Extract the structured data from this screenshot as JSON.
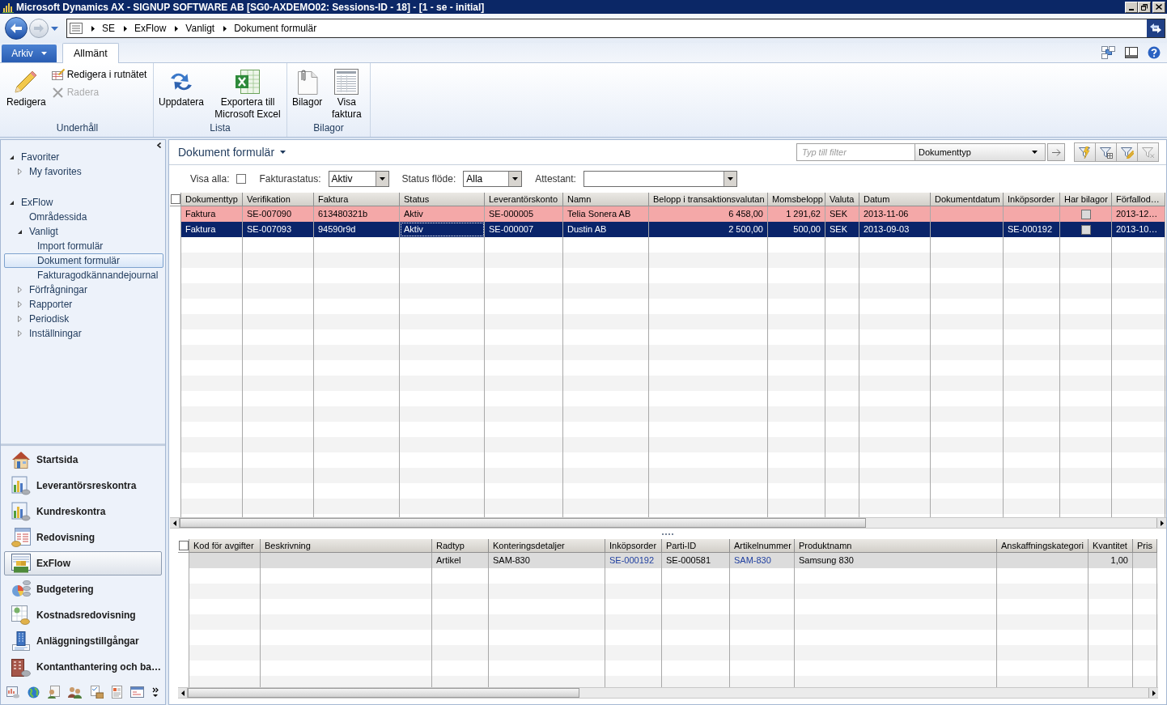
{
  "window": {
    "title": "Microsoft Dynamics AX - SIGNUP SOFTWARE AB [SG0-AXDEMO02: Sessions-ID - 18] - [1 - se - initial]"
  },
  "address_bar": {
    "breadcrumbs": [
      "SE",
      "ExFlow",
      "Vanligt",
      "Dokument formulär"
    ]
  },
  "ribbon": {
    "file_menu": {
      "label": "Arkiv"
    },
    "tabs": [
      {
        "label": "Allmänt",
        "selected": true
      }
    ],
    "groups": [
      {
        "label": "Underhåll",
        "buttons": [
          {
            "label": "Redigera",
            "kind": "large",
            "disabled": false
          },
          {
            "label": "Redigera i rutnätet",
            "kind": "small",
            "disabled": false
          },
          {
            "label": "Radera",
            "kind": "small",
            "disabled": true
          }
        ]
      },
      {
        "label": "Lista",
        "buttons": [
          {
            "label": "Uppdatera",
            "kind": "large",
            "disabled": false
          },
          {
            "label": "Exportera till Microsoft Excel",
            "kind": "large",
            "disabled": false
          }
        ]
      },
      {
        "label": "Bilagor",
        "buttons": [
          {
            "label": "Bilagor",
            "kind": "large",
            "disabled": false
          },
          {
            "label": "Visa faktura",
            "kind": "large",
            "disabled": false
          }
        ]
      }
    ]
  },
  "nav_pane": {
    "tree": [
      {
        "label": "Favoriter",
        "expanded": true,
        "selected": false,
        "children": [
          {
            "label": "My favorites",
            "expanded": false,
            "selected": false
          }
        ]
      },
      {
        "label": "ExFlow",
        "expanded": true,
        "selected": false,
        "children": [
          {
            "label": "Områdessida",
            "selected": false
          },
          {
            "label": "Vanligt",
            "expanded": true,
            "selected": false,
            "children": [
              {
                "label": "Import formulär",
                "selected": false
              },
              {
                "label": "Dokument formulär",
                "selected": true
              },
              {
                "label": "Fakturagodkännandejournal",
                "selected": false
              }
            ]
          },
          {
            "label": "Förfrågningar",
            "expanded": false,
            "selected": false
          },
          {
            "label": "Rapporter",
            "expanded": false,
            "selected": false
          },
          {
            "label": "Periodisk",
            "expanded": false,
            "selected": false
          },
          {
            "label": "Inställningar",
            "expanded": false,
            "selected": false
          }
        ]
      }
    ],
    "modules": [
      {
        "label": "Startsida",
        "selected": false
      },
      {
        "label": "Leverantörsreskontra",
        "selected": false
      },
      {
        "label": "Kundreskontra",
        "selected": false
      },
      {
        "label": "Redovisning",
        "selected": false
      },
      {
        "label": "ExFlow",
        "selected": true
      },
      {
        "label": "Budgetering",
        "selected": false
      },
      {
        "label": "Kostnadsredovisning",
        "selected": false
      },
      {
        "label": "Anläggningstillgångar",
        "selected": false
      },
      {
        "label": "Kontanthantering och ba…",
        "selected": false
      }
    ]
  },
  "form": {
    "title": "Dokument formulär",
    "quick_filter": {
      "placeholder": "Typ till filter",
      "field": "Dokumenttyp"
    },
    "filters": [
      {
        "label": "Visa alla:",
        "kind": "checkbox",
        "checked": false
      },
      {
        "label": "Fakturastatus:",
        "kind": "dropdown",
        "value": "Aktiv"
      },
      {
        "label": "Status flöde:",
        "kind": "dropdown",
        "value": "Alla"
      },
      {
        "label": "Attestant:",
        "kind": "dropdown"
      }
    ]
  },
  "documents": {
    "all_selected": false,
    "columns": [
      {
        "label": "Dokumenttyp",
        "kind": "text"
      },
      {
        "label": "Verifikation",
        "kind": "text"
      },
      {
        "label": "Faktura",
        "kind": "text"
      },
      {
        "label": "Status",
        "kind": "text"
      },
      {
        "label": "Leverantörskonto",
        "kind": "text"
      },
      {
        "label": "Namn",
        "kind": "text"
      },
      {
        "label": "Belopp i transaktionsvalutan",
        "kind": "amount"
      },
      {
        "label": "Momsbelopp",
        "kind": "amount"
      },
      {
        "label": "Valuta",
        "kind": "text"
      },
      {
        "label": "Datum",
        "kind": "text"
      },
      {
        "label": "Dokumentdatum",
        "kind": "text"
      },
      {
        "label": "Inköpsorder",
        "kind": "text"
      },
      {
        "label": "Har bilagor",
        "kind": "checkbox"
      },
      {
        "label": "Förfallod…",
        "kind": "text"
      }
    ],
    "rows": [
      {
        "selected": false,
        "highlighted": true,
        "cells": [
          "Faktura",
          "SE-007090",
          "613480321b",
          "Aktiv",
          "SE-000005",
          "Telia Sonera AB",
          "6 458,00",
          "1 291,62",
          "SEK",
          "2013-11-06",
          null,
          null,
          false,
          "2013-12…"
        ]
      },
      {
        "selected": true,
        "highlighted": false,
        "cells": [
          "Faktura",
          "SE-007093",
          "94590r9d",
          {
            "text": "Aktiv",
            "focused": true
          },
          "SE-000007",
          "Dustin AB",
          "2 500,00",
          "500,00",
          "SEK",
          "2013-09-03",
          null,
          "SE-000192",
          false,
          "2013-10…"
        ]
      }
    ]
  },
  "lines": {
    "all_selected": false,
    "columns": [
      {
        "label": "Kod för avgifter",
        "kind": "text"
      },
      {
        "label": "Beskrivning",
        "kind": "text"
      },
      {
        "label": "Radtyp",
        "kind": "text"
      },
      {
        "label": "Konteringsdetaljer",
        "kind": "text"
      },
      {
        "label": "Inköpsorder",
        "kind": "link"
      },
      {
        "label": "Parti-ID",
        "kind": "text"
      },
      {
        "label": "Artikelnummer",
        "kind": "link"
      },
      {
        "label": "Produktnamn",
        "kind": "text"
      },
      {
        "label": "Anskaffningskategori",
        "kind": "text"
      },
      {
        "label": "Kvantitet",
        "kind": "amount"
      },
      {
        "label": "Pris",
        "kind": "text"
      }
    ],
    "rows": [
      {
        "selected": true,
        "cells": [
          null,
          null,
          "Artikel",
          "SAM-830",
          "SE-000192",
          "SE-000581",
          "SAM-830",
          "Samsung 830",
          null,
          "1,00",
          null
        ]
      }
    ]
  }
}
